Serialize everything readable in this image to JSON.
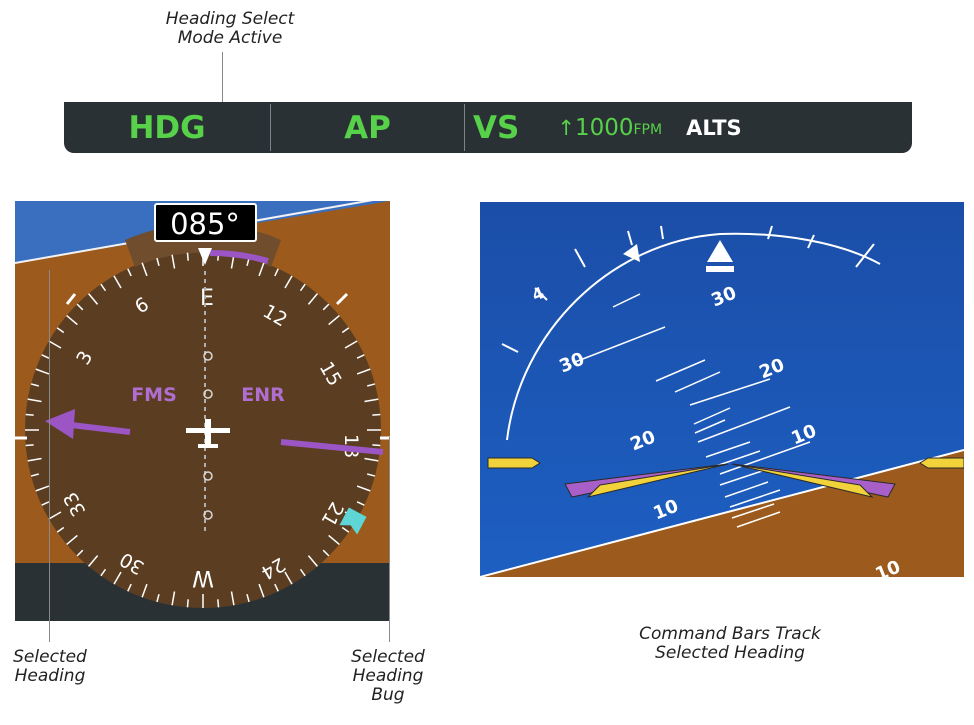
{
  "fma": {
    "lateral_mode": "HDG",
    "autopilot": "AP",
    "vertical_mode": "VS",
    "vertical_speed_arrow": "↑",
    "vertical_speed_value": "1000",
    "vertical_speed_unit": "FPM",
    "armed_mode": "ALTS"
  },
  "hsi": {
    "selected_heading": "085°",
    "cardinal_east": "E",
    "cardinal_west": "W",
    "label_6": "6",
    "label_3": "3",
    "label_12": "12",
    "label_15": "15",
    "label_18": "18",
    "label_21": "21",
    "label_24": "24",
    "label_30": "30",
    "label_33": "33",
    "nav_source": "FMS",
    "phase": "ENR"
  },
  "adi": {
    "pitch_30_left": "30",
    "pitch_30_right": "20",
    "pitch_20_left": "20",
    "pitch_10_right": "10",
    "pitch_10_left": "10",
    "pitch_top_partial": "30",
    "pitch_bottom_partial": "10",
    "pitch_left_partial": "4"
  },
  "callouts": {
    "hdg_mode_line1": "Heading Select",
    "hdg_mode_line2": "Mode Active",
    "selected_heading_line1": "Selected",
    "selected_heading_line2": "Heading",
    "bug_line1": "Selected",
    "bug_line2": "Heading",
    "bug_line3": "Bug",
    "command_bars_line1": "Command Bars Track",
    "command_bars_line2": "Selected Heading"
  },
  "colors": {
    "fma_background": "#2a3134",
    "active_mode": "#57d04a",
    "magenta": "#a860c8",
    "cyan_bug": "#5fd6d6",
    "sky": "#1a4fa6",
    "ground": "#9c5a1c",
    "command_bar_fill": "#f2d23a"
  }
}
